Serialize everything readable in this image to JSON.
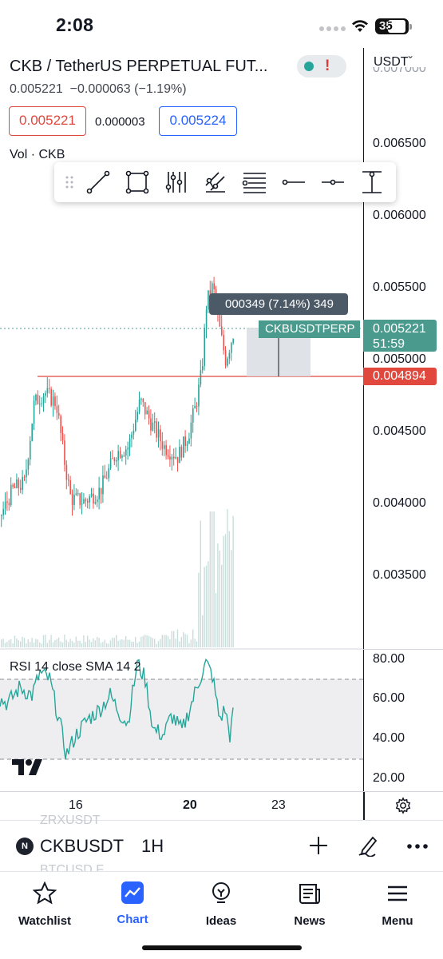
{
  "status_bar": {
    "time": "2:08",
    "battery": "35"
  },
  "header": {
    "title": "CKB / TetherUS PERPETUAL FUT...",
    "price": "0.005221",
    "change": "−0.000063 (−1.19%)",
    "currency": "USDTˇ",
    "bid": "0.005221",
    "spread": "0.000003",
    "ask": "0.005224",
    "volume_label": "Vol · CKB"
  },
  "toolbar": {
    "tools": [
      "trend-line-icon",
      "rectangle-icon",
      "fib-icon",
      "pitchfork-icon",
      "channel-icon",
      "horizontal-ray-icon",
      "horizontal-line-icon",
      "price-range-icon"
    ]
  },
  "chart_data": [
    {
      "type": "candlestick",
      "series": [
        {
          "name": "CKBUSDTPERP"
        }
      ],
      "y_ticks": [
        "0.007000",
        "0.006500",
        "0.006000",
        "0.005500",
        "0.005000",
        "0.004500",
        "0.004000",
        "0.003500"
      ],
      "x_ticks": [
        "16",
        "20",
        "23"
      ],
      "last_price": "0.005221",
      "countdown": "51:59",
      "horizontal_level": "0.004894",
      "measure": "000349 (7.14%) 349",
      "symbol_tag": "CKBUSDTPERP"
    },
    {
      "type": "line",
      "title": "RSI 14 close SMA 14 2",
      "y_ticks": [
        "80.00",
        "60.00",
        "40.00",
        "20.00"
      ],
      "bands": [
        70,
        30
      ]
    }
  ],
  "symbol_bar": {
    "ghost_above": "ZRXUSDT",
    "symbol": "CKBUSDT",
    "interval": "1H",
    "ghost_below": "BTCUSD.F",
    "exchange_logo": "N"
  },
  "tabs": [
    {
      "label": "Watchlist",
      "icon": "star-icon"
    },
    {
      "label": "Chart",
      "icon": "chart-icon",
      "active": true
    },
    {
      "label": "Ideas",
      "icon": "bulb-icon"
    },
    {
      "label": "News",
      "icon": "news-icon"
    },
    {
      "label": "Menu",
      "icon": "menu-icon"
    }
  ],
  "colors": {
    "up": "#26a69a",
    "down": "#ef5350",
    "accent": "#2962ff",
    "level": "#e0483d",
    "last_price": "#4a9a8e"
  }
}
